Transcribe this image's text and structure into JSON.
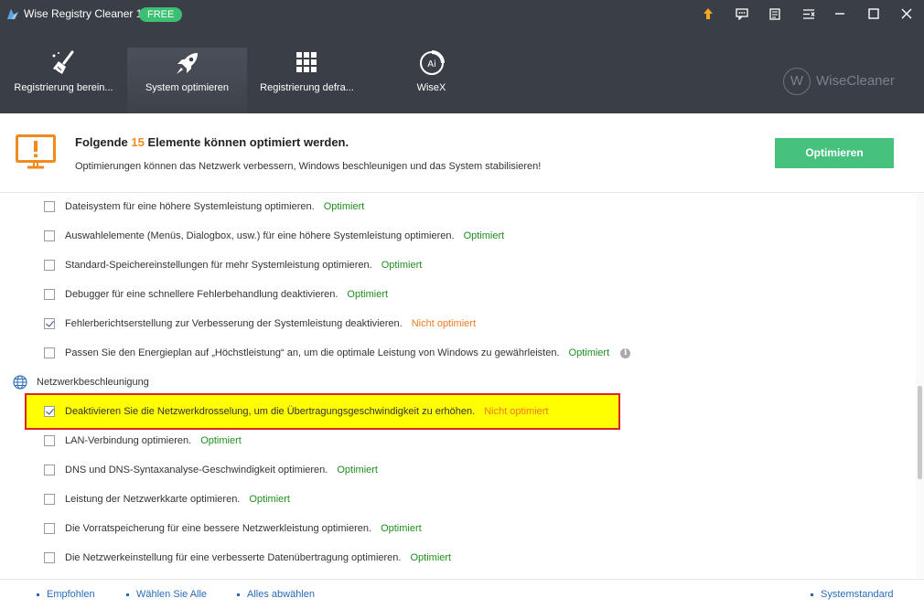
{
  "window": {
    "title": "Wise Registry Cleaner 11",
    "badge": "FREE",
    "controls": [
      "upgrade-icon",
      "feedback-icon",
      "notes-icon",
      "settings-icon",
      "minimize-icon",
      "maximize-icon",
      "close-icon"
    ]
  },
  "nav": {
    "tabs": [
      {
        "label": "Registrierung berein...",
        "icon": "broom-icon",
        "active": false
      },
      {
        "label": "System optimieren",
        "icon": "rocket-icon",
        "active": true
      },
      {
        "label": "Registrierung defra...",
        "icon": "grid-icon",
        "active": false
      },
      {
        "label": "WiseX",
        "icon": "wisex-icon",
        "active": false
      }
    ],
    "brand_letter": "W",
    "brand": "WiseCleaner"
  },
  "header": {
    "title_prefix": "Folgende",
    "count": "15",
    "title_suffix": "Elemente können optimiert werden.",
    "description": "Optimierungen können das Netzwerk verbessern, Windows beschleunigen und das System stabilisieren!",
    "button": "Optimieren"
  },
  "items": [
    {
      "text": "Dateisystem für eine höhere Systemleistung optimieren.",
      "status": "Optimiert",
      "checked": false
    },
    {
      "text": "Auswahlelemente (Menüs, Dialogbox, usw.) für eine höhere Systemleistung optimieren.",
      "status": "Optimiert",
      "checked": false
    },
    {
      "text": "Standard-Speichereinstellungen für mehr Systemleistung optimieren.",
      "status": "Optimiert",
      "checked": false
    },
    {
      "text": "Debugger für eine schnellere Fehlerbehandlung deaktivieren.",
      "status": "Optimiert",
      "checked": false
    },
    {
      "text": "Fehlerberichtserstellung zur Verbesserung der Systemleistung deaktivieren.",
      "status": "Nicht optimiert",
      "checked": true
    },
    {
      "text": "Passen Sie den Energieplan auf „Höchstleistung“ an, um die optimale Leistung von Windows zu gewährleisten.",
      "status": "Optimiert",
      "checked": false
    }
  ],
  "section": {
    "label": "Netzwerkbeschleunigung",
    "icon": "globe-icon"
  },
  "network_items": [
    {
      "text": "Deaktivieren Sie die Netzwerkdrosselung, um die Übertragungsgeschwindigkeit zu erhöhen.",
      "status": "Nicht optimiert",
      "checked": true
    },
    {
      "text": "LAN-Verbindung optimieren.",
      "status": "Optimiert",
      "checked": false
    },
    {
      "text": "DNS und DNS-Syntaxanalyse-Geschwindigkeit optimieren.",
      "status": "Optimiert",
      "checked": false
    },
    {
      "text": "Leistung der Netzwerkkarte optimieren.",
      "status": "Optimiert",
      "checked": false
    },
    {
      "text": "Die Vorratspeicherung für eine bessere Netzwerkleistung optimieren.",
      "status": "Optimiert",
      "checked": false
    },
    {
      "text": "Die Netzwerkeinstellung für eine verbesserte Datenübertragung optimieren.",
      "status": "Optimiert",
      "checked": false
    }
  ],
  "footer": {
    "recommended": "Empfohlen",
    "select_all": "Wählen Sie Alle",
    "deselect_all": "Alles abwählen",
    "system_default": "Systemstandard"
  },
  "colors": {
    "titlebar": "#3a3f47",
    "accent_green": "#47c27c",
    "status_ok": "#1e8e1e",
    "status_not": "#f07a1e",
    "highlight": "#ffff00",
    "highlight_border": "#e02424",
    "link": "#2a6bb8"
  }
}
